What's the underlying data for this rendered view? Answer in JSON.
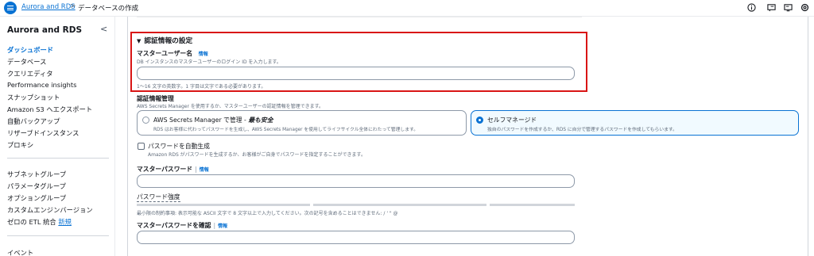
{
  "header": {
    "breadcrumb_link": "Aurora and RDS",
    "breadcrumb_sep": ">",
    "breadcrumb_current": "データベースの作成"
  },
  "sidebar": {
    "title": "Aurora and RDS",
    "collapse_glyph": "<",
    "items": [
      "ダッシュボード",
      "データベース",
      "クエリエディタ",
      "Performance insights",
      "スナップショット",
      "Amazon S3 へエクスポート",
      "自動バックアップ",
      "リザーブドインスタンス",
      "プロキシ"
    ],
    "items2": [
      "サブネットグループ",
      "パラメータグループ",
      "オプショングループ",
      "カスタムエンジンバージョン",
      "ゼロの ETL 統合"
    ],
    "new_badge": "新規",
    "events": "イベント"
  },
  "form": {
    "section_title": "認証情報の設定",
    "master_username_label": "マスターユーザー名",
    "info": "情報",
    "master_username_desc": "DB インスタンスのマスターユーザーのログイン ID を入力します。",
    "master_username_value": "",
    "master_username_hint": "1〜16 文字の英数字。1 字目は文字である必要があります。",
    "cred_mgmt_label": "認証情報管理",
    "cred_mgmt_desc": "AWS Secrets Manager を使用するか、マスターユーザーの認証情報を管理できます。",
    "option_asm_title": "AWS Secrets Manager で管理 - ",
    "option_asm_emph": "最も安全",
    "option_asm_desc": "RDS はお客様に代わってパスワードを生成し、AWS Secrets Manager を使用してライフサイクル全体にわたって管理します。",
    "option_self_title": "セルフマネージド",
    "option_self_desc": "独自のパスワードを作成するか、RDS に自分で管理するパスワードを作成してもらいます。",
    "autogen_label": "パスワードを自動生成",
    "autogen_desc": "Amazon RDS がパスワードを生成するか、お客様がご自身でパスワードを指定することができます。",
    "master_password_label": "マスターパスワード",
    "strength_label": "パスワード強度",
    "password_constraints": "最小限の制約事項: 表示可能な ASCII 文字で 8 文字以上で入力してください。次の記号を含めることはできません: / ' \" @",
    "confirm_password_label": "マスターパスワードを確認"
  },
  "colors": {
    "accent": "#0972d3",
    "highlight": "#d91515",
    "selected_bg": "#f1faff"
  },
  "icons": [
    "menu-icon",
    "info-circle-icon",
    "notifications-icon",
    "display-icon",
    "settings-icon"
  ]
}
